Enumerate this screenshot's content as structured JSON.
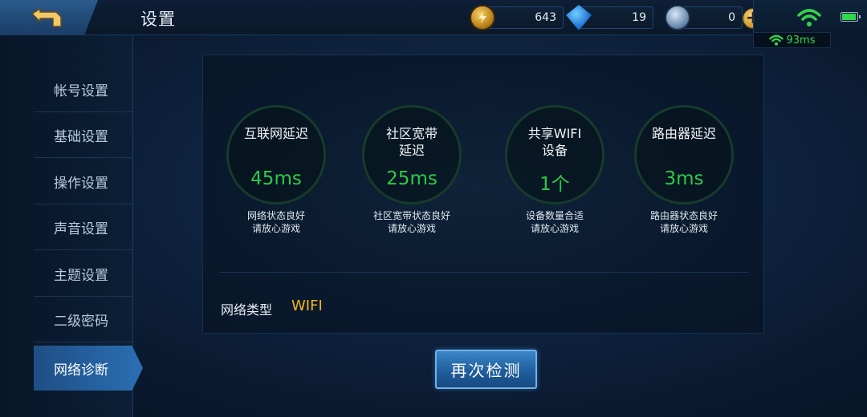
{
  "header": {
    "title": "设置",
    "back_icon": "back-arrow-icon",
    "currencies": [
      {
        "icon": "gold-coin-icon",
        "value": "643"
      },
      {
        "icon": "diamond-icon",
        "value": "19"
      },
      {
        "icon": "crystal-gem-icon",
        "value": "0"
      }
    ],
    "ping": "93ms",
    "wifi_icon": "wifi-icon",
    "battery_icon": "battery-icon"
  },
  "sidebar": {
    "items": [
      {
        "label": "帐号设置"
      },
      {
        "label": "基础设置"
      },
      {
        "label": "操作设置"
      },
      {
        "label": "声音设置"
      },
      {
        "label": "主题设置"
      },
      {
        "label": "二级密码"
      },
      {
        "label": "网络诊断",
        "active": true
      }
    ]
  },
  "diagnostics": {
    "metrics": [
      {
        "label": "互联网延迟",
        "value": "45ms",
        "desc": "网络状态良好\n请放心游戏"
      },
      {
        "label": "社区宽带\n延迟",
        "value": "25ms",
        "desc": "社区宽带状态良好\n请放心游戏"
      },
      {
        "label": "共享WIFI\n设备",
        "value": "1个",
        "desc": "设备数量合适\n请放心游戏"
      },
      {
        "label": "路由器延迟",
        "value": "3ms",
        "desc": "路由器状态良好\n请放心游戏"
      }
    ],
    "network_type_label": "网络类型",
    "network_type_value": "WIFI",
    "retest_label": "再次检测"
  },
  "colors": {
    "accent_green": "#2ec94a",
    "accent_gold": "#f2b51c",
    "active_tab": "#2b6fb4"
  }
}
